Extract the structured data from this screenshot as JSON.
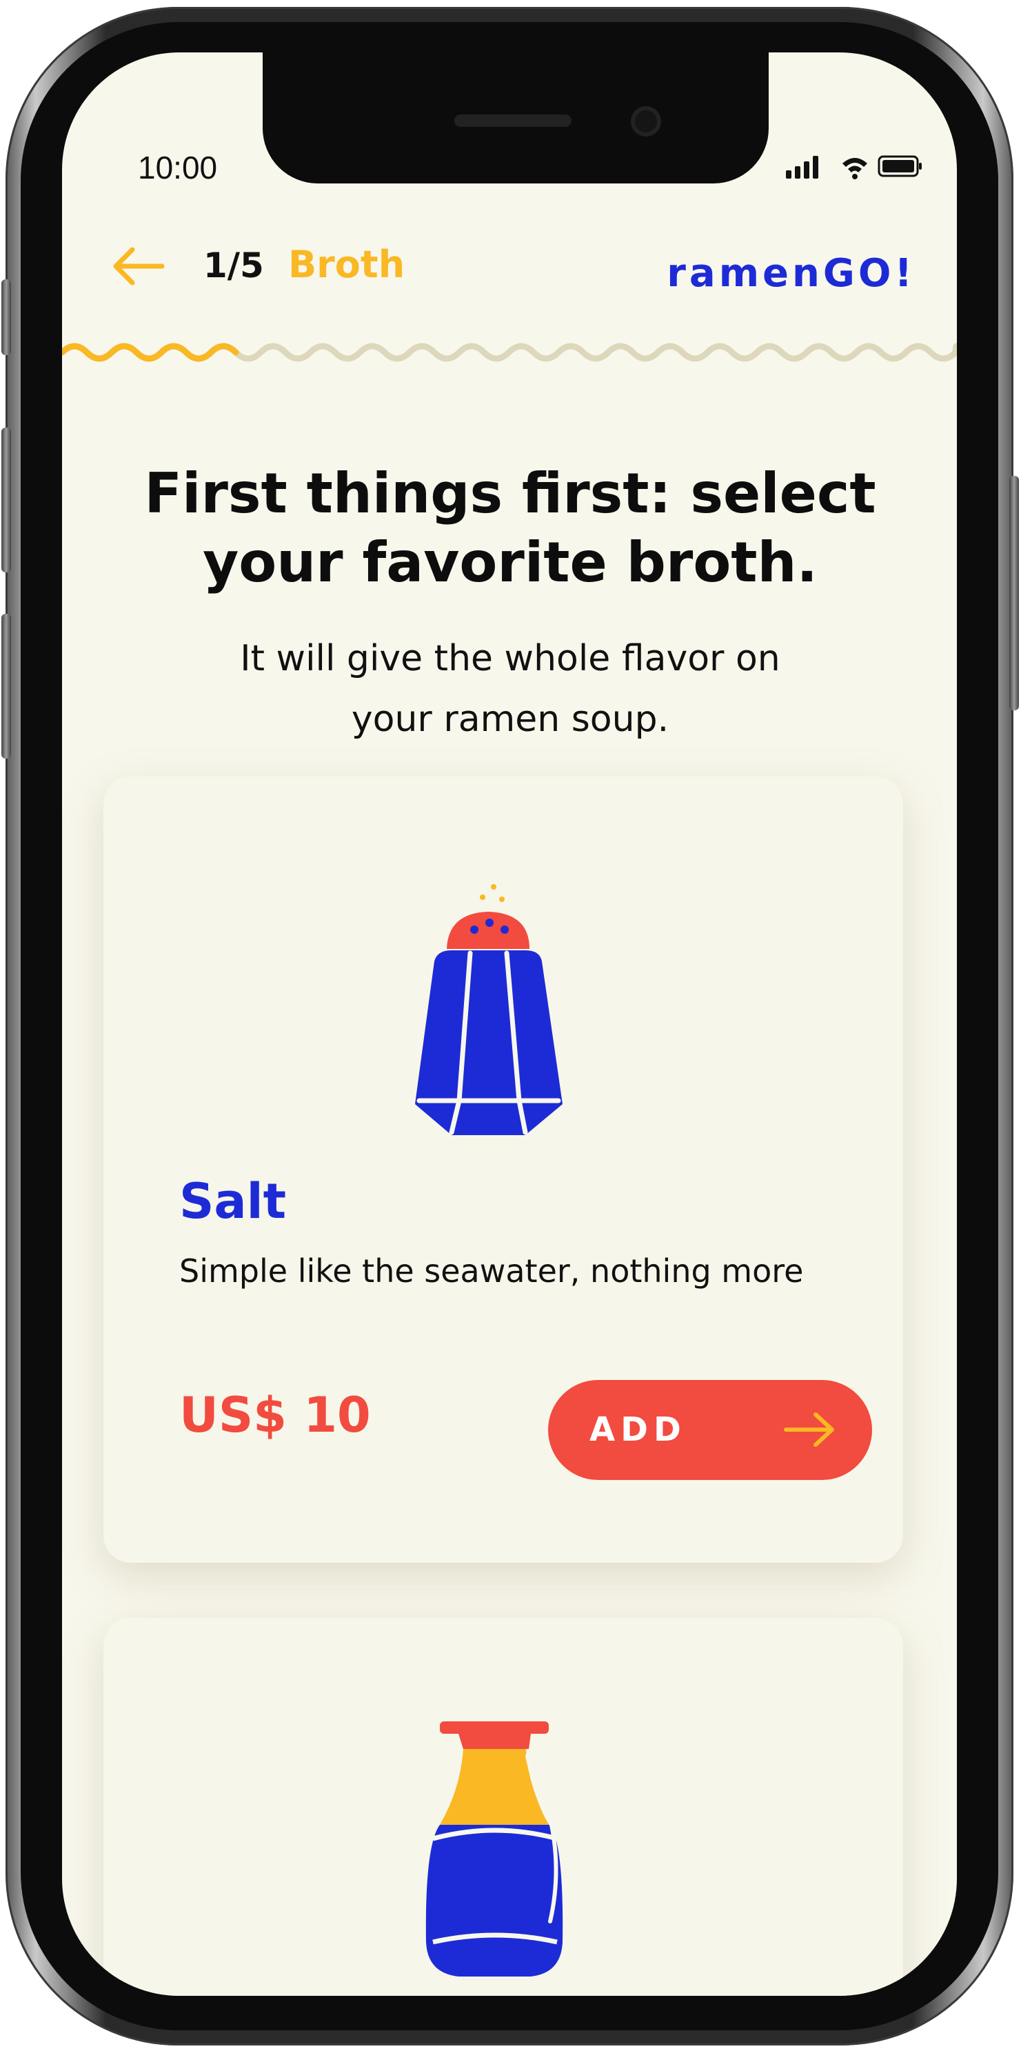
{
  "status_bar": {
    "time": "10:00"
  },
  "header": {
    "step_count": "1/5",
    "step_name": "Broth",
    "brand": "ramenGO!",
    "progress_fraction": 0.2
  },
  "intro": {
    "headline": "First things first: select your favorite broth.",
    "subtext": "It will give the whole flavor on your ramen soup."
  },
  "products": [
    {
      "name": "Salt",
      "description": "Simple like the seawater, nothing more",
      "price": "US$ 10",
      "button_label": "ADD",
      "icon": "salt-shaker-icon"
    },
    {
      "icon": "soy-sauce-bottle-icon"
    }
  ],
  "colors": {
    "background": "#f8f7ec",
    "accent_yellow": "#f9b824",
    "brand_blue": "#1d2bd6",
    "accent_red": "#f24b3f",
    "text": "#111111"
  }
}
